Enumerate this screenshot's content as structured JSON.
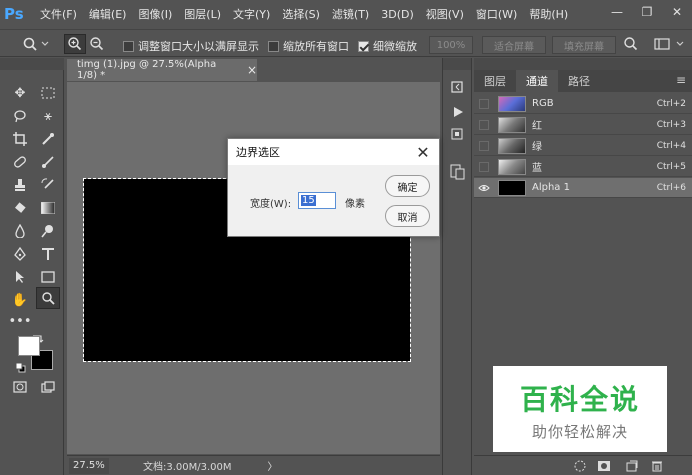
{
  "app": {
    "logo": "Ps"
  },
  "menu": [
    "文件(F)",
    "编辑(E)",
    "图像(I)",
    "图层(L)",
    "文字(Y)",
    "选择(S)",
    "滤镜(T)",
    "3D(D)",
    "视图(V)",
    "窗口(W)",
    "帮助(H)"
  ],
  "window_controls": {
    "minimize": "—",
    "restore": "❐",
    "close": "✕"
  },
  "options": {
    "resize_windows_label": "调整窗口大小以满屏显示",
    "resize_windows_checked": false,
    "zoom_all_label": "缩放所有窗口",
    "zoom_all_checked": false,
    "scrubby_zoom_label": "细微缩放",
    "scrubby_zoom_checked": true,
    "btn_100": "100%",
    "btn_fit": "适合屏幕",
    "btn_fill": "填充屏幕"
  },
  "document": {
    "tab_title": "timg (1).jpg @ 27.5%(Alpha 1/8) *",
    "tab_close": "×",
    "zoom": "27.5%",
    "doc_info": "文档:3.00M/3.00M",
    "info_arrow": "〉"
  },
  "dialog": {
    "title": "边界选区",
    "close": "✕",
    "width_label": "宽度(W):",
    "width_value": "15",
    "unit": "像素",
    "ok": "确定",
    "cancel": "取消"
  },
  "channels_panel": {
    "tabs": [
      "图层",
      "通道",
      "路径"
    ],
    "active_tab": "通道",
    "menu_icon": "≡",
    "rows": [
      {
        "name": "RGB",
        "shortcut": "Ctrl+2",
        "visible": false,
        "thumb": "color"
      },
      {
        "name": "红",
        "shortcut": "Ctrl+3",
        "visible": false,
        "thumb": "gray"
      },
      {
        "name": "绿",
        "shortcut": "Ctrl+4",
        "visible": false,
        "thumb": "gray"
      },
      {
        "name": "蓝",
        "shortcut": "Ctrl+5",
        "visible": false,
        "thumb": "gray"
      },
      {
        "name": "Alpha 1",
        "shortcut": "Ctrl+6",
        "visible": true,
        "thumb": "black"
      }
    ]
  },
  "watermark": {
    "title": "百科全说",
    "subtitle": "助你轻松解决"
  },
  "colors": {
    "ps_blue": "#4aa8ff",
    "panel_bg": "#535353",
    "canvas_bg": "#6e6e6e",
    "watermark_green": "#2fb24c"
  }
}
